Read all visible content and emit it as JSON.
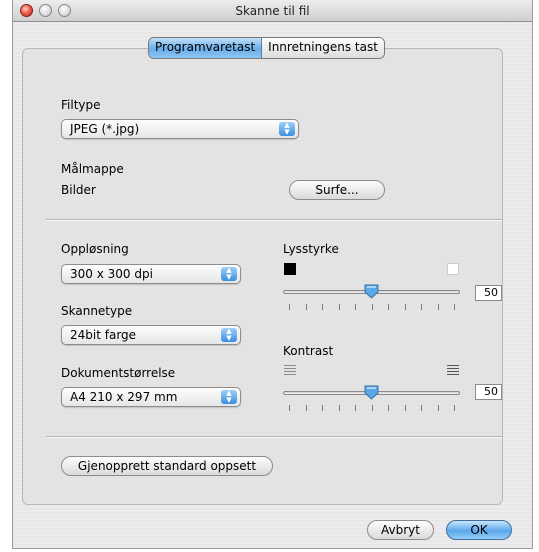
{
  "window": {
    "title": "Skanne til fil"
  },
  "tabs": [
    {
      "label": "Programvaretast",
      "active": true
    },
    {
      "label": "Innretningens tast",
      "active": false
    }
  ],
  "filetype": {
    "label": "Filtype",
    "value": "JPEG (*.jpg)"
  },
  "destination": {
    "label": "Målmappe",
    "folder": "Bilder",
    "browse_label": "Surfe..."
  },
  "resolution": {
    "label": "Oppløsning",
    "value": "300 x 300 dpi"
  },
  "scantype": {
    "label": "Skannetype",
    "value": "24bit farge"
  },
  "docsize": {
    "label": "Dokumentstørrelse",
    "value": "A4 210 x 297 mm"
  },
  "brightness": {
    "label": "Lysstyrke",
    "value": "50",
    "level": 50,
    "ticks": 11
  },
  "contrast": {
    "label": "Kontrast",
    "value": "50",
    "level": 50,
    "ticks": 11
  },
  "restore_label": "Gjenopprett standard oppsett",
  "footer": {
    "cancel_label": "Avbryt",
    "ok_label": "OK"
  },
  "colors": {
    "accent": "#5ba7ea"
  }
}
